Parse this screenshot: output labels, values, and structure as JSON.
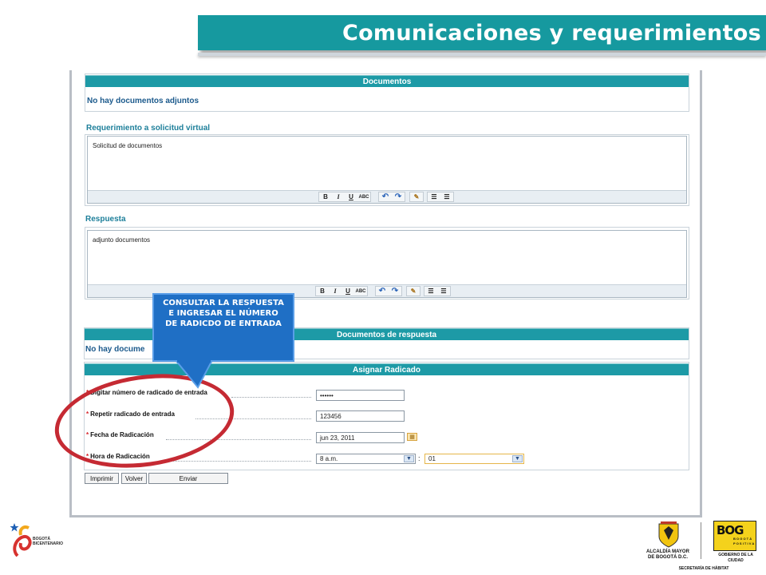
{
  "slide": {
    "title": "Comunicaciones y requerimientos"
  },
  "documentos": {
    "header": "Documentos",
    "empty_text": "No hay documentos adjuntos"
  },
  "requerimiento": {
    "label": "Requerimiento a solicitud virtual",
    "content": "Solicitud de documentos"
  },
  "respuesta": {
    "label": "Respuesta",
    "content": "adjunto documentos"
  },
  "toolbar": {
    "bold": "B",
    "italic": "I",
    "underline": "U",
    "strike": "ABC",
    "undo": "↶",
    "redo": "↷",
    "clean": "✎",
    "bullets": "☰",
    "numbers": "☰"
  },
  "documentos_respuesta": {
    "header": "Documentos de respuesta",
    "empty_text": "No hay docume"
  },
  "asignar": {
    "header": "Asignar Radicado",
    "rows": [
      {
        "label": "Digitar número de radicado de entrada",
        "value": "••••••"
      },
      {
        "label": "Repetir radicado de entrada",
        "value": "123456"
      },
      {
        "label": "Fecha de Radicación",
        "value": "jun 23, 2011"
      },
      {
        "label": "Hora de Radicación",
        "hour": "8 a.m.",
        "minute": "01"
      }
    ],
    "colon": ":"
  },
  "actions": {
    "print": "Imprimir",
    "back": "Volver",
    "send": "Enviar"
  },
  "callout": {
    "text": "CONSULTAR LA RESPUESTA E INGRESAR EL NÚMERO DE RADICDO DE ENTRADA"
  },
  "logos": {
    "left_line1": "BOGOTÁ",
    "left_line2": "BICENTENARIO",
    "right_alcaldia": "ALCALDÍA MAYOR\nDE BOGOTÁ D.C.",
    "right_secretaria": "SECRETARÍA DE HÁBITAT",
    "bog_main": "BOG",
    "bog_sub1": "B O G O T Á",
    "bog_sub2": "P O S I T I V A",
    "bog_gobierno": "GOBIERNO DE LA CIUDAD"
  },
  "colors": {
    "banner": "#16999f",
    "section_bar": "#1d9aa6",
    "callout": "#1f6fc5",
    "highlight_ring": "#c52a33"
  }
}
